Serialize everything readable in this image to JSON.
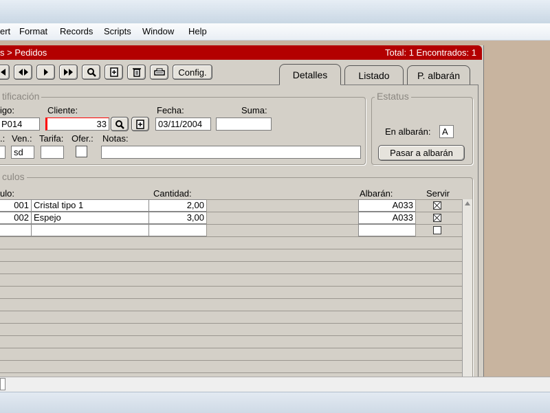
{
  "menu": [
    "ert",
    "Format",
    "Records",
    "Scripts",
    "Window",
    "Help"
  ],
  "header": {
    "breadcrumb": "s > Pedidos",
    "counts": "Total: 1 Encontrados: 1"
  },
  "toolbar": {
    "config_label": "Config."
  },
  "tabs": [
    "Detalles",
    "Listado",
    "P. albarán"
  ],
  "identificacion": {
    "title": "tificación",
    "codigo_label": "igo:",
    "codigo_value": "P014",
    "cliente_label": "Cliente:",
    "cliente_value": "33",
    "fecha_label": "Fecha:",
    "fecha_value": "03/11/2004",
    "suma_label": "Suma:",
    "suma_value": "",
    "small_label": ".:",
    "ven_label": "Ven.:",
    "ven_value": "sd",
    "tarifa_label": "Tarifa:",
    "ofer_label": "Ofer.:",
    "notas_label": "Notas:"
  },
  "estatus": {
    "title": "Estatus",
    "en_albaran_label": "En albarán:",
    "en_albaran_value": "A",
    "pasar_button": "Pasar a albarán"
  },
  "articulos": {
    "title": "culos",
    "col_articulo": "ulo:",
    "col_cantidad": "Cantidad:",
    "col_albaran": "Albarán:",
    "col_servir": "Servir",
    "rows": [
      {
        "code": "001",
        "desc": "Cristal tipo 1",
        "cantidad": "2,00",
        "albaran": "A033",
        "servir": true
      },
      {
        "code": "002",
        "desc": "Espejo",
        "cantidad": "3,00",
        "albaran": "A033",
        "servir": true
      },
      {
        "code": "",
        "desc": "",
        "cantidad": "",
        "albaran": "",
        "servir": false
      }
    ]
  },
  "colors": {
    "header_bg": "#b30000",
    "window_bg": "#d4d0c8",
    "desktop": "#c8b49f"
  }
}
